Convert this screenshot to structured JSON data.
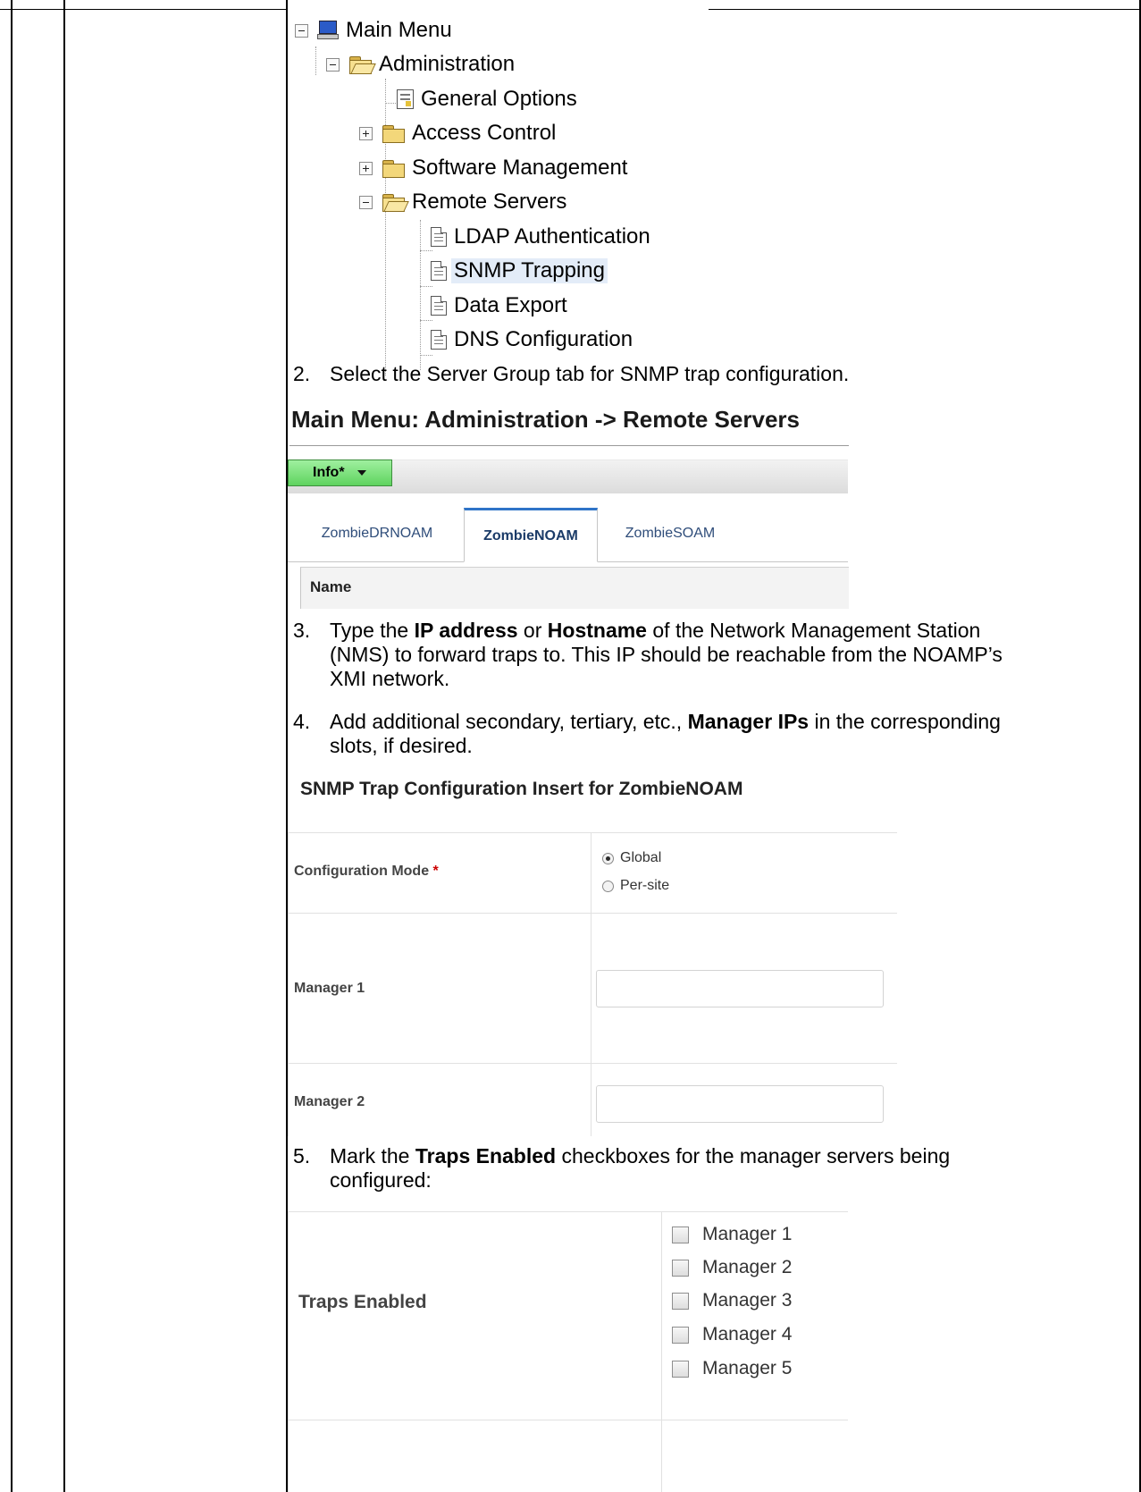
{
  "tree": {
    "root": "Main Menu",
    "administration": "Administration",
    "general_options": "General Options",
    "access_control": "Access Control",
    "software_management": "Software Management",
    "remote_servers": "Remote Servers",
    "ldap": "LDAP Authentication",
    "snmp": "SNMP Trapping",
    "data_export": "Data Export",
    "dns": "DNS Configuration"
  },
  "steps": {
    "s2_num": "2.",
    "s2_text": "Select the Server Group tab for SNMP trap configuration.",
    "s3_num": "3.",
    "s3_line1_a": "Type the ",
    "s3_line1_b": "IP address",
    "s3_line1_c": " or ",
    "s3_line1_d": "Hostname",
    "s3_line1_e": " of the Network Management Station",
    "s3_line2": "(NMS) to forward traps to.  This IP should be reachable from the NOAMP’s",
    "s3_line3": "XMI network.",
    "s4_num": "4.",
    "s4_line1_a": "Add additional secondary, tertiary, etc., ",
    "s4_line1_b": "Manager IPs",
    "s4_line1_c": " in the corresponding",
    "s4_line2": "slots, if desired.",
    "s5_num": "5.",
    "s5_line1_a": "Mark the ",
    "s5_line1_b": "Traps Enabled",
    "s5_line1_c": " checkboxes for the manager servers being",
    "s5_line2": "configured:"
  },
  "remote_servers_page": {
    "title": "Main Menu: Administration -> Remote Servers",
    "info_button": "Info*",
    "tabs": [
      "ZombieDRNOAM",
      "ZombieNOAM",
      "ZombieSOAM"
    ],
    "active_tab": "ZombieNOAM",
    "column_header": "Name"
  },
  "snmp_form": {
    "title": "SNMP Trap Configuration Insert for ZombieNOAM",
    "config_mode_label": "Configuration Mode",
    "required_mark": "*",
    "options": [
      "Global",
      "Per-site"
    ],
    "selected_option": "Global",
    "manager1_label": "Manager 1",
    "manager1_value": "",
    "manager2_label": "Manager 2",
    "manager2_value": ""
  },
  "traps": {
    "label": "Traps Enabled",
    "checkboxes": [
      "Manager 1",
      "Manager 2",
      "Manager 3",
      "Manager 4",
      "Manager 5"
    ],
    "checked": [
      false,
      false,
      false,
      false,
      false
    ]
  }
}
